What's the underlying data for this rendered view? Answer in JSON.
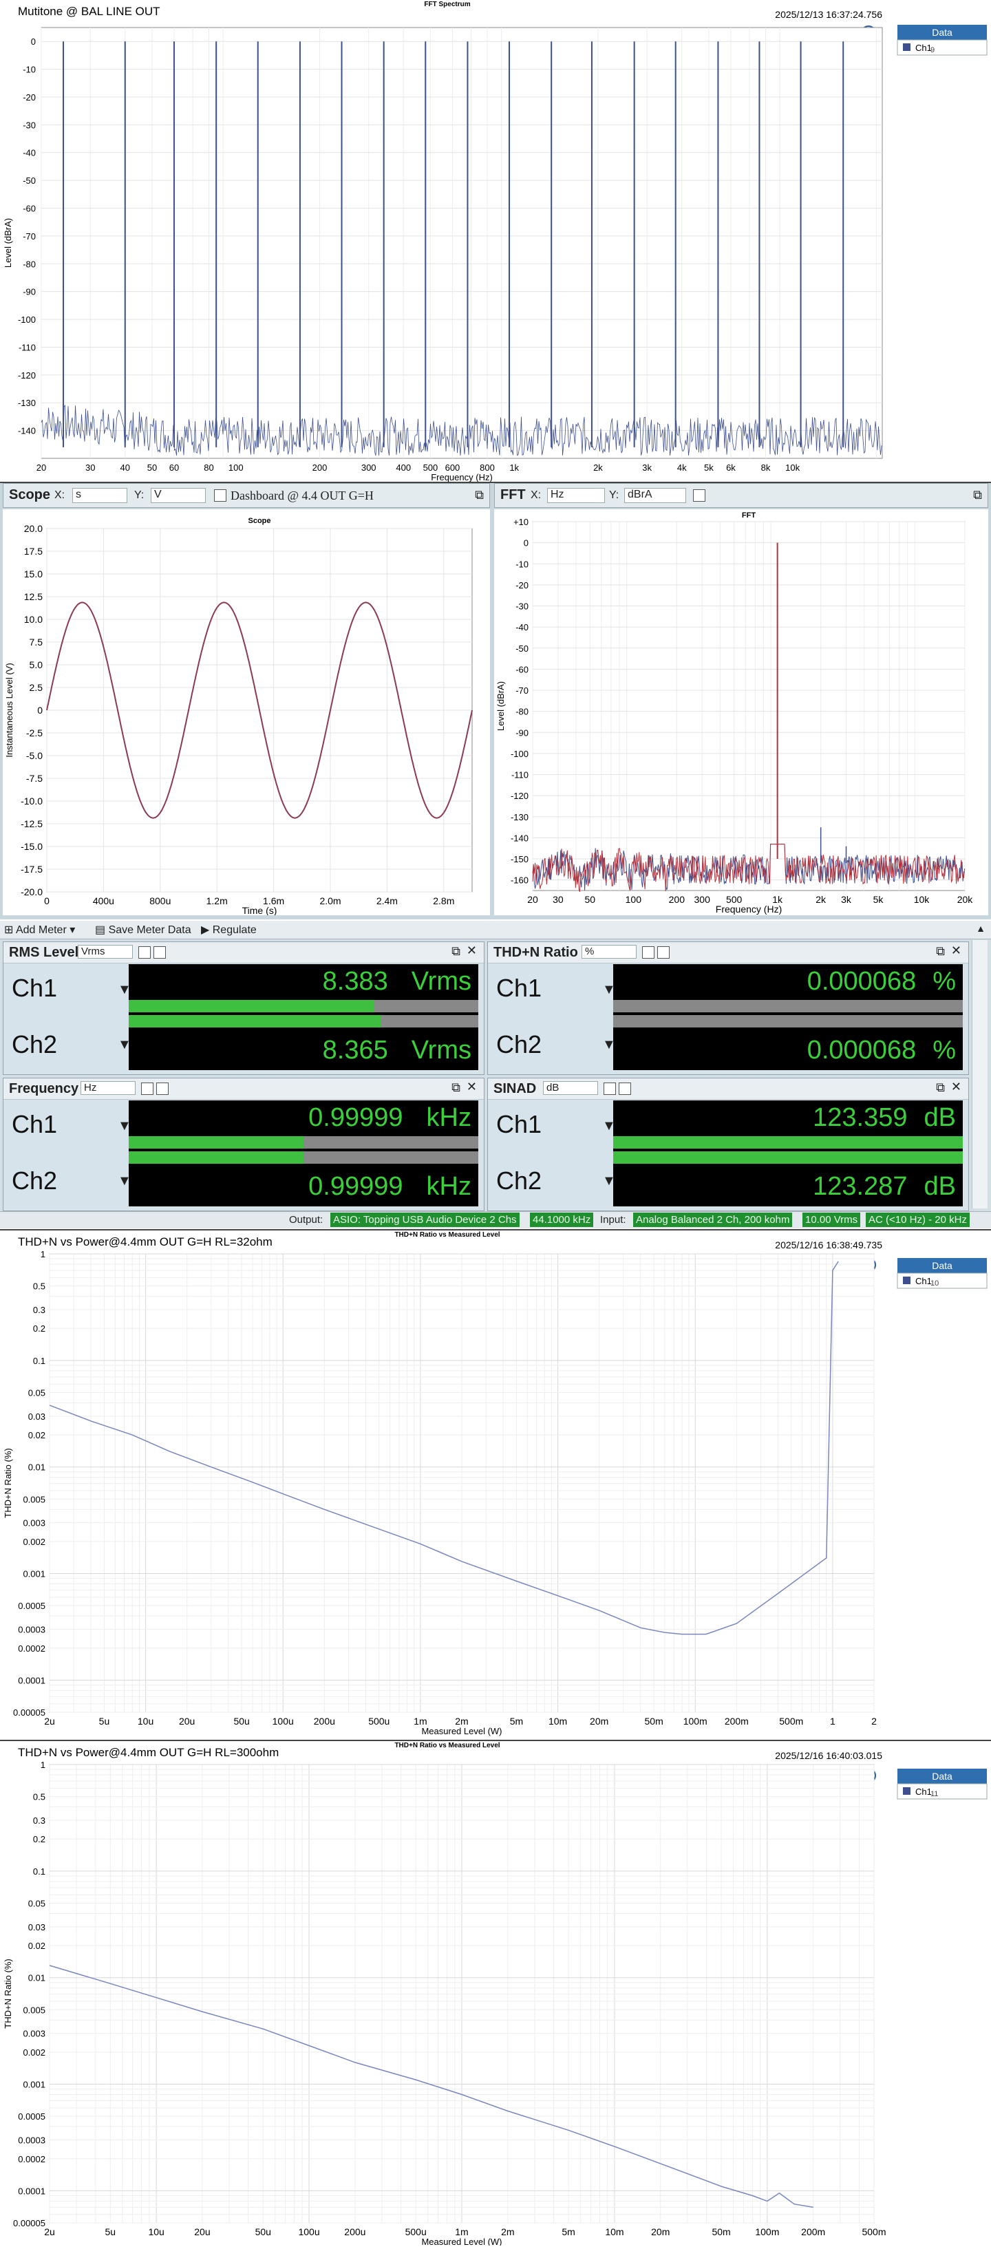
{
  "fft_top": {
    "header_left": "Mutitone @ BAL LINE OUT",
    "title": "FFT Spectrum",
    "timestamp": "2025/12/13 16:37:24.756",
    "ylabel": "Level (dBrA)",
    "xlabel": "Frequency (Hz)",
    "legend_title": "Data",
    "legend_item": "Ch1",
    "legend_suffix": "9",
    "y_ticks": [
      "0",
      "-10",
      "-20",
      "-30",
      "-40",
      "-50",
      "-60",
      "-70",
      "-80",
      "-90",
      "-100",
      "-110",
      "-120",
      "-130",
      "-140"
    ],
    "x_ticks": [
      "20",
      "30",
      "40",
      "50",
      "60",
      "80",
      "100",
      "200",
      "300",
      "400",
      "500",
      "600",
      "800",
      "1k",
      "2k",
      "3k",
      "4k",
      "5k",
      "6k",
      "8k",
      "10k"
    ]
  },
  "scope": {
    "panel_title": "Scope",
    "x_label": "X:",
    "x_unit": "s",
    "y_label": "Y:",
    "y_unit": "V",
    "dashboard": "Dashboard  @ 4.4 OUT G=H",
    "chart_title": "Scope",
    "ylabel": "Instantaneous Level (V)",
    "xlabel": "Time (s)",
    "y_ticks": [
      "20.0",
      "17.5",
      "15.0",
      "12.5",
      "10.0",
      "7.5",
      "5.0",
      "2.5",
      "0",
      "-2.5",
      "-5.0",
      "-7.5",
      "-10.0",
      "-12.5",
      "-15.0",
      "-17.5",
      "-20.0"
    ],
    "x_ticks": [
      "0",
      "400u",
      "800u",
      "1.2m",
      "1.6m",
      "2.0m",
      "2.4m",
      "2.8m"
    ]
  },
  "fft_small": {
    "panel_title": "FFT",
    "x_label": "X:",
    "x_unit": "Hz",
    "y_label": "Y:",
    "y_unit": "dBrA",
    "chart_title": "FFT",
    "ylabel": "Level (dBrA)",
    "xlabel": "Frequency (Hz)",
    "y_ticks": [
      "+10",
      "0",
      "-10",
      "-20",
      "-30",
      "-40",
      "-50",
      "-60",
      "-70",
      "-80",
      "-90",
      "-100",
      "-110",
      "-120",
      "-130",
      "-140",
      "-150",
      "-160"
    ],
    "x_ticks": [
      "20",
      "30",
      "50",
      "100",
      "200",
      "300",
      "500",
      "1k",
      "2k",
      "3k",
      "5k",
      "10k",
      "20k"
    ]
  },
  "toolbar": {
    "add_meter": "Add Meter",
    "save_meter_data": "Save Meter Data",
    "regulate": "Regulate"
  },
  "meters": {
    "rms": {
      "label": "RMS Level",
      "unit": "Vrms",
      "ch1": "8.383",
      "ch2": "8.365",
      "unit_suffix": "Vrms"
    },
    "thdn": {
      "label": "THD+N Ratio",
      "unit": "%",
      "ch1": "0.000068",
      "ch2": "0.000068",
      "unit_suffix": "%"
    },
    "freq": {
      "label": "Frequency",
      "unit": "Hz",
      "ch1": "0.99999",
      "ch2": "0.99999",
      "unit_suffix": "kHz"
    },
    "sinad": {
      "label": "SINAD",
      "unit": "dB",
      "ch1": "123.359",
      "ch2": "123.287",
      "unit_suffix": "dB"
    },
    "ch1": "Ch1",
    "ch2": "Ch2"
  },
  "status": {
    "output_label": "Output:",
    "output_device": "ASIO: Topping USB Audio Device 2 Chs",
    "output_rate": "44.1000 kHz",
    "input_label": "Input:",
    "input_device": "Analog Balanced 2 Ch, 200 kohm",
    "input_range": "10.00 Vrms",
    "input_filter": "AC (<10 Hz) - 20 kHz"
  },
  "thd32": {
    "header_left": "THD+N vs Power@4.4mm OUT G=H RL=32ohm",
    "title": "THD+N Ratio vs Measured Level",
    "timestamp": "2025/12/16 16:38:49.735",
    "ylabel": "THD+N Ratio (%)",
    "xlabel": "Measured Level (W)",
    "legend_title": "Data",
    "legend_item": "Ch1",
    "legend_suffix": "10",
    "y_ticks": [
      "1",
      "0.5",
      "0.3",
      "0.2",
      "0.1",
      "0.05",
      "0.03",
      "0.02",
      "0.01",
      "0.005",
      "0.003",
      "0.002",
      "0.001",
      "0.0005",
      "0.0003",
      "0.0002",
      "0.0001",
      "0.00005"
    ],
    "x_ticks": [
      "2u",
      "5u",
      "10u",
      "20u",
      "50u",
      "100u",
      "200u",
      "500u",
      "1m",
      "2m",
      "5m",
      "10m",
      "20m",
      "50m",
      "100m",
      "200m",
      "500m",
      "1",
      "2"
    ]
  },
  "thd300": {
    "header_left": "THD+N vs Power@4.4mm OUT G=H RL=300ohm",
    "title": "THD+N Ratio vs Measured Level",
    "timestamp": "2025/12/16 16:40:03.015",
    "ylabel": "THD+N Ratio (%)",
    "xlabel": "Measured Level (W)",
    "legend_title": "Data",
    "legend_item": "Ch1",
    "legend_suffix": "11",
    "y_ticks": [
      "1",
      "0.5",
      "0.3",
      "0.2",
      "0.1",
      "0.05",
      "0.03",
      "0.02",
      "0.01",
      "0.005",
      "0.003",
      "0.002",
      "0.001",
      "0.0005",
      "0.0003",
      "0.0002",
      "0.0001",
      "0.00005"
    ],
    "x_ticks": [
      "2u",
      "5u",
      "10u",
      "20u",
      "50u",
      "100u",
      "200u",
      "500u",
      "1m",
      "2m",
      "5m",
      "10m",
      "20m",
      "50m",
      "100m",
      "200m",
      "500m"
    ]
  },
  "colors": {
    "ch1": "#3d4f8f",
    "ch2": "#b5313a",
    "scope_line": "#8a3b4f",
    "meter_green": "#3ccf3c",
    "status_green": "#1f8f2f"
  },
  "chart_data": [
    {
      "type": "line",
      "title": "FFT Spectrum",
      "xlabel": "Frequency (Hz)",
      "ylabel": "Level (dBrA)",
      "xscale": "log",
      "xlim": [
        20,
        21000
      ],
      "ylim": [
        -150,
        5
      ],
      "tones_hz": [
        24,
        40,
        60,
        85,
        120,
        170,
        240,
        340,
        480,
        680,
        960,
        1360,
        1900,
        2700,
        3800,
        5400,
        7600,
        10700,
        15200
      ],
      "tone_level_dB": 0,
      "noise_floor_dB": -142,
      "series": [
        {
          "name": "Ch1",
          "values": "multitone"
        }
      ]
    },
    {
      "type": "line",
      "title": "Scope",
      "xlabel": "Time (s)",
      "ylabel": "Instantaneous Level (V)",
      "xlim": [
        0,
        0.003
      ],
      "ylim": [
        -20,
        20
      ],
      "amplitude_V": 11.86,
      "frequency_Hz": 1000,
      "series": [
        {
          "name": "Ch1"
        }
      ]
    },
    {
      "type": "line",
      "title": "FFT",
      "xlabel": "Frequency (Hz)",
      "ylabel": "Level (dBrA)",
      "xscale": "log",
      "xlim": [
        20,
        20000
      ],
      "ylim": [
        -165,
        10
      ],
      "fundamental_Hz": 1000,
      "fundamental_dB": 0,
      "harmonics": [
        {
          "x": 2000,
          "y": -135
        },
        {
          "x": 3000,
          "y": -144
        }
      ],
      "noise_floor_dB": -155,
      "series": [
        {
          "name": "Ch1"
        },
        {
          "name": "Ch2"
        }
      ]
    },
    {
      "type": "line",
      "title": "THD+N Ratio vs Measured Level",
      "xlabel": "Measured Level (W)",
      "ylabel": "THD+N Ratio (%)",
      "xscale": "log",
      "yscale": "log",
      "xlim": [
        2e-06,
        2
      ],
      "ylim": [
        5e-05,
        1
      ],
      "series": [
        {
          "name": "Ch1",
          "x": [
            2e-06,
            4e-06,
            8e-06,
            1.5e-05,
            3e-05,
            6e-05,
            0.0001,
            0.0002,
            0.0004,
            0.001,
            0.002,
            0.005,
            0.01,
            0.02,
            0.04,
            0.06,
            0.08,
            0.12,
            0.2,
            0.4,
            0.9,
            1.0,
            1.1
          ],
          "y": [
            0.038,
            0.027,
            0.02,
            0.014,
            0.01,
            0.0072,
            0.0056,
            0.004,
            0.0029,
            0.0019,
            0.0013,
            0.00085,
            0.00062,
            0.00045,
            0.00031,
            0.00028,
            0.00027,
            0.00027,
            0.00034,
            0.00065,
            0.0014,
            0.7,
            0.85
          ]
        }
      ]
    },
    {
      "type": "line",
      "title": "THD+N Ratio vs Measured Level",
      "xlabel": "Measured Level (W)",
      "ylabel": "THD+N Ratio (%)",
      "xscale": "log",
      "yscale": "log",
      "xlim": [
        2e-06,
        0.5
      ],
      "ylim": [
        5e-05,
        1
      ],
      "series": [
        {
          "name": "Ch1",
          "x": [
            2e-06,
            5e-06,
            1e-05,
            2e-05,
            5e-05,
            0.0001,
            0.0002,
            0.0005,
            0.001,
            0.002,
            0.005,
            0.01,
            0.02,
            0.05,
            0.08,
            0.1,
            0.12,
            0.15,
            0.2
          ],
          "y": [
            0.013,
            0.0088,
            0.0065,
            0.0048,
            0.0033,
            0.0023,
            0.0016,
            0.0011,
            0.0008,
            0.00056,
            0.00037,
            0.00026,
            0.00018,
            0.00011,
            9e-05,
            8e-05,
            9.5e-05,
            7.5e-05,
            7e-05
          ]
        }
      ]
    }
  ]
}
